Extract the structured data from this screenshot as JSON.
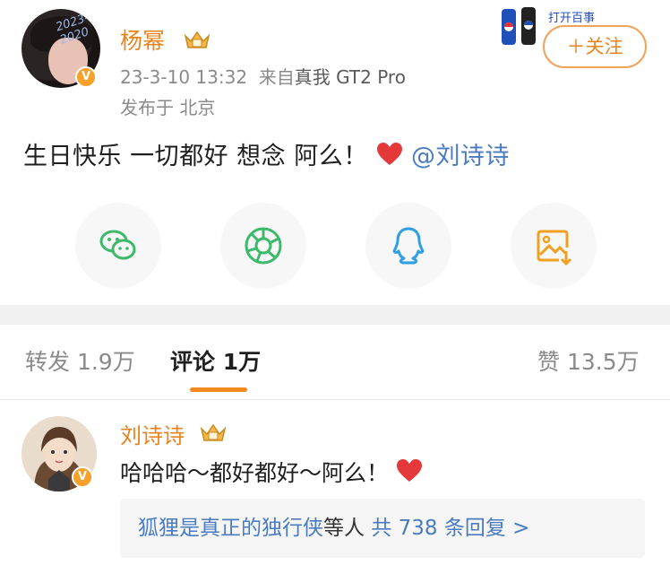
{
  "post": {
    "author": "杨幂",
    "verified_mark": "V",
    "time": "23-3-10 13:32",
    "source_prefix": "来自",
    "device": "真我 GT2 Pro",
    "location": "发布于 北京",
    "avatar_doodle": "2023-2020",
    "text": "生日快乐 一切都好 想念 阿么！",
    "mention": "@刘诗诗",
    "follow_label": "＋关注",
    "promo_text": "打开百事",
    "icons": [
      "crown-icon",
      "heart-icon"
    ]
  },
  "share": [
    {
      "name": "wechat-share-button",
      "icon": "wechat-icon"
    },
    {
      "name": "moments-share-button",
      "icon": "moments-icon"
    },
    {
      "name": "qq-share-button",
      "icon": "qq-icon"
    },
    {
      "name": "save-image-button",
      "icon": "save-image-icon"
    }
  ],
  "tabs": {
    "repost": "转发 1.9万",
    "comment": "评论 1万",
    "like": "赞 13.5万"
  },
  "comment": {
    "author": "刘诗诗",
    "verified_mark": "V",
    "text": "哈哈哈～都好都好～阿么！",
    "reply_user": "狐狸是真正的独行侠",
    "reply_suffix": "等人",
    "reply_count": "共 738 条回复 >"
  },
  "colors": {
    "accent": "#e8831e",
    "link": "#4a7cbf",
    "heart": "#e5383b"
  }
}
